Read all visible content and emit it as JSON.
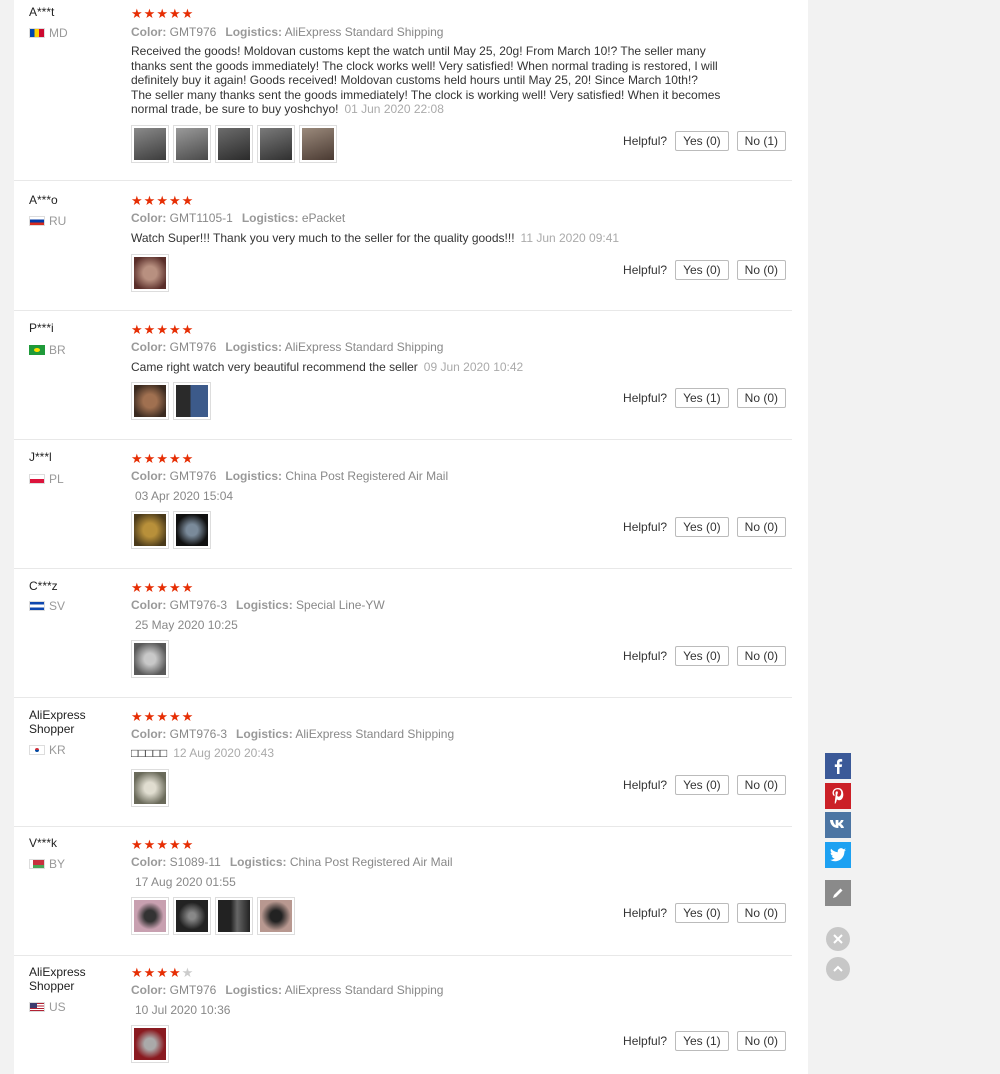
{
  "labels": {
    "helpful": "Helpful?",
    "color": "Color:",
    "logistics": "Logistics:"
  },
  "reviews": [
    {
      "user": "A***t",
      "country": "MD",
      "stars": 5,
      "color": "GMT976",
      "logistics": "AliExpress Standard Shipping",
      "text": "Received the goods! Moldovan customs kept the watch until May 25, 20g! From March 10!? The seller many thanks sent the goods immediately! The clock works well! Very satisfied! When normal trading is restored, I will definitely buy it again! Goods received! Moldovan customs held hours until May 25, 20! Since March 10th!? The seller many thanks sent the goods immediately! The clock is working well! Very satisfied! When it becomes normal trade, be sure to buy yoshchyo!",
      "date": "01 Jun 2020 22:08",
      "yes": "Yes (0)",
      "no": "No (1)"
    },
    {
      "user": "A***o",
      "country": "RU",
      "stars": 5,
      "color": "GMT1105-1",
      "logistics": "ePacket",
      "text": "Watch Super!!! Thank you very much to the seller for the quality goods!!!",
      "date": "11 Jun 2020 09:41",
      "yes": "Yes (0)",
      "no": "No (0)"
    },
    {
      "user": "P***i",
      "country": "BR",
      "stars": 5,
      "color": "GMT976",
      "logistics": "AliExpress Standard Shipping",
      "text": "Came right watch very beautiful recommend the seller",
      "date": "09 Jun 2020 10:42",
      "yes": "Yes (1)",
      "no": "No (0)"
    },
    {
      "user": "J***l",
      "country": "PL",
      "stars": 5,
      "color": "GMT976",
      "logistics": "China Post Registered Air Mail",
      "text": "",
      "date": "03 Apr 2020 15:04",
      "yes": "Yes (0)",
      "no": "No (0)"
    },
    {
      "user": "C***z",
      "country": "SV",
      "stars": 5,
      "color": "GMT976-3",
      "logistics": "Special Line-YW",
      "text": "",
      "date": "25 May 2020 10:25",
      "yes": "Yes (0)",
      "no": "No (0)"
    },
    {
      "user": "AliExpress Shopper",
      "country": "KR",
      "stars": 5,
      "color": "GMT976-3",
      "logistics": "AliExpress Standard Shipping",
      "text": "□□□□□",
      "date": "12 Aug 2020 20:43",
      "yes": "Yes (0)",
      "no": "No (0)"
    },
    {
      "user": "V***k",
      "country": "BY",
      "stars": 5,
      "color": "S1089-11",
      "logistics": "China Post Registered Air Mail",
      "text": "",
      "date": "17 Aug 2020 01:55",
      "yes": "Yes (0)",
      "no": "No (0)"
    },
    {
      "user": "AliExpress Shopper",
      "country": "US",
      "stars": 4,
      "color": "GMT976",
      "logistics": "AliExpress Standard Shipping",
      "text": "",
      "date": "10 Jul 2020 10:36",
      "yes": "Yes (1)",
      "no": "No (0)"
    }
  ],
  "share": [
    "facebook-icon",
    "pinterest-icon",
    "vk-icon",
    "twitter-icon"
  ],
  "colors": {
    "star": "#e62e04",
    "facebook": "#3b5998",
    "pinterest": "#cb2027",
    "vk": "#4c75a3",
    "twitter": "#1da1f2"
  }
}
